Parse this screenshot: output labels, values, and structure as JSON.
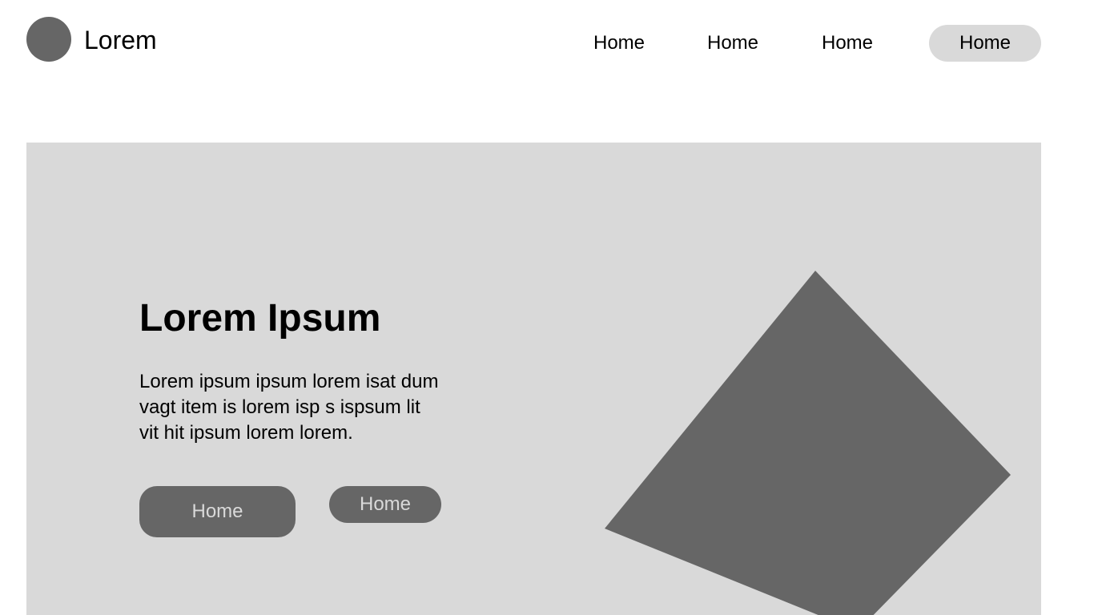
{
  "header": {
    "brand": "Lorem",
    "nav": [
      "Home",
      "Home",
      "Home",
      "Home"
    ]
  },
  "hero": {
    "title": "Lorem Ipsum",
    "text": "Lorem ipsum ipsum lorem isat dum\nvagt item is lorem  isp s ispsum lit\nvit hit ipsum lorem lorem.",
    "primary_button": "Home",
    "secondary_button": "Home"
  },
  "colors": {
    "placeholder_dark": "#666666",
    "placeholder_light": "#d9d9d9",
    "background": "#ffffff"
  }
}
